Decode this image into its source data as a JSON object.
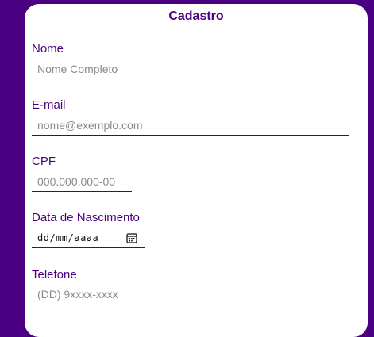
{
  "form": {
    "title": "Cadastro",
    "fields": {
      "nome": {
        "label": "Nome",
        "placeholder": "Nome Completo"
      },
      "email": {
        "label": "E-mail",
        "placeholder": "nome@exemplo.com"
      },
      "cpf": {
        "label": "CPF",
        "placeholder": "000.000.000-00"
      },
      "nascimento": {
        "label": "Data de Nascimento",
        "value_format": "dd/mm/aaaa",
        "icon": "calendar-icon"
      },
      "telefone": {
        "label": "Telefone",
        "placeholder": "(DD) 9xxxx-xxxx"
      }
    }
  },
  "colors": {
    "background": "#4b0082",
    "accent": "#4b0082",
    "card": "#ffffff"
  }
}
